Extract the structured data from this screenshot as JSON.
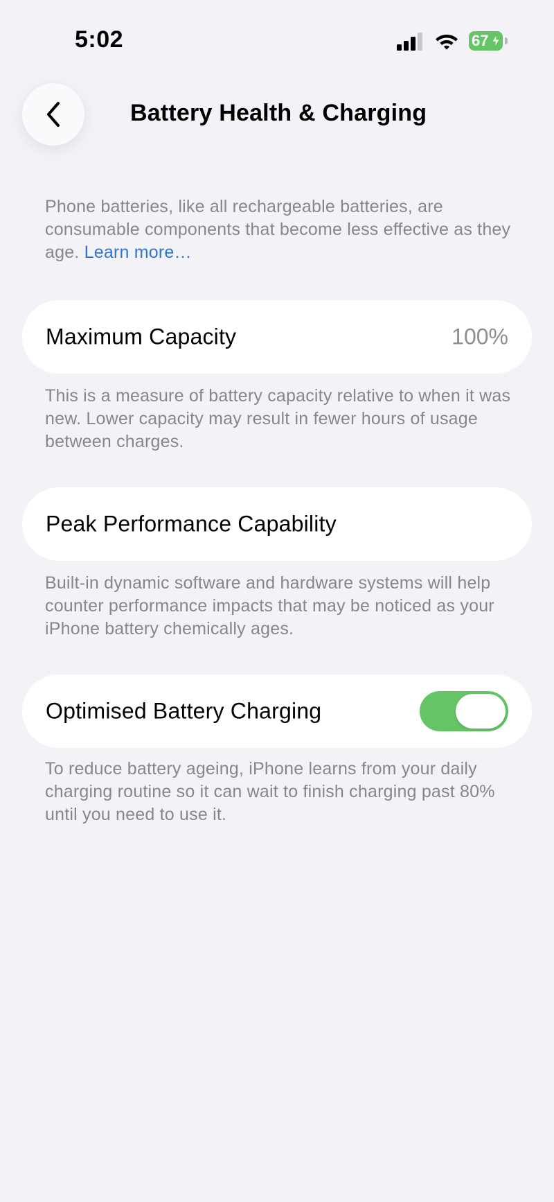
{
  "status_bar": {
    "time": "5:02",
    "battery_level": "67",
    "battery_color": "#65c466",
    "icons": [
      "cellular-signal-icon",
      "wifi-icon",
      "battery-charging-icon"
    ]
  },
  "nav": {
    "back_icon": "chevron-left-icon",
    "title": "Battery Health & Charging"
  },
  "intro": {
    "text": "Phone batteries, like all rechargeable batteries, are consumable components that become less effective as they age. ",
    "link": "Learn more…",
    "link_color": "#2e73d6"
  },
  "maximum_capacity": {
    "label": "Maximum Capacity",
    "value": "100%",
    "description": "This is a measure of battery capacity relative to when it was new. Lower capacity may result in fewer hours of usage between charges."
  },
  "peak_performance": {
    "label": "Peak Performance Capability",
    "description": "Built-in dynamic software and hardware systems will help counter performance impacts that may be noticed as your iPhone battery chemically ages."
  },
  "optimised_charging": {
    "label": "Optimised Battery Charging",
    "enabled": true,
    "toggle_color": "#65c466",
    "description": "To reduce battery ageing, iPhone learns from your daily charging routine so it can wait to finish charging past 80% until you need to use it."
  }
}
